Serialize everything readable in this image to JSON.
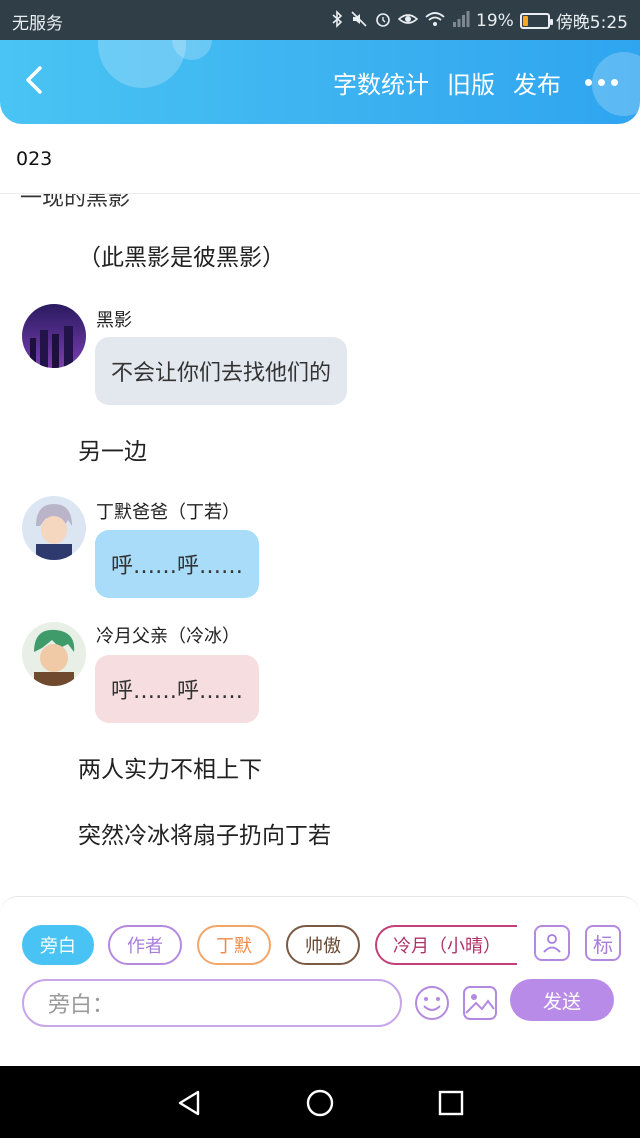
{
  "status_bar": {
    "carrier": "无服务",
    "battery": "19%",
    "battery_level": 0.19,
    "time": "傍晚5:25"
  },
  "app_bar": {
    "word_count": "字数统计",
    "old_version": "旧版",
    "publish": "发布"
  },
  "title": "023",
  "content": {
    "clipped_text": "一现的黑影",
    "narration_1": "（此黑影是彼黑影）",
    "msg_1": {
      "speaker": "黑影",
      "text": "不会让你们去找他们的"
    },
    "narration_2": "另一边",
    "msg_2": {
      "speaker": "丁默爸爸（丁若）",
      "text": "呼……呼……"
    },
    "msg_3": {
      "speaker": "冷月父亲（冷冰）",
      "text": "呼……呼……"
    },
    "narration_3": "两人实力不相上下",
    "narration_4": "突然冷冰将扇子扔向丁若"
  },
  "input_panel": {
    "chips": [
      "旁白",
      "作者",
      "丁默",
      "帅傲",
      "冷月（小晴）"
    ],
    "tag_button": "标",
    "input_placeholder": "旁白：",
    "send": "发送"
  },
  "colors": {
    "accent": "#48c3f3",
    "purple": "#b98be8",
    "bubble_grey": "#e3e7ee",
    "bubble_blue": "#a8dcf8",
    "bubble_pink": "#f5dde0"
  }
}
